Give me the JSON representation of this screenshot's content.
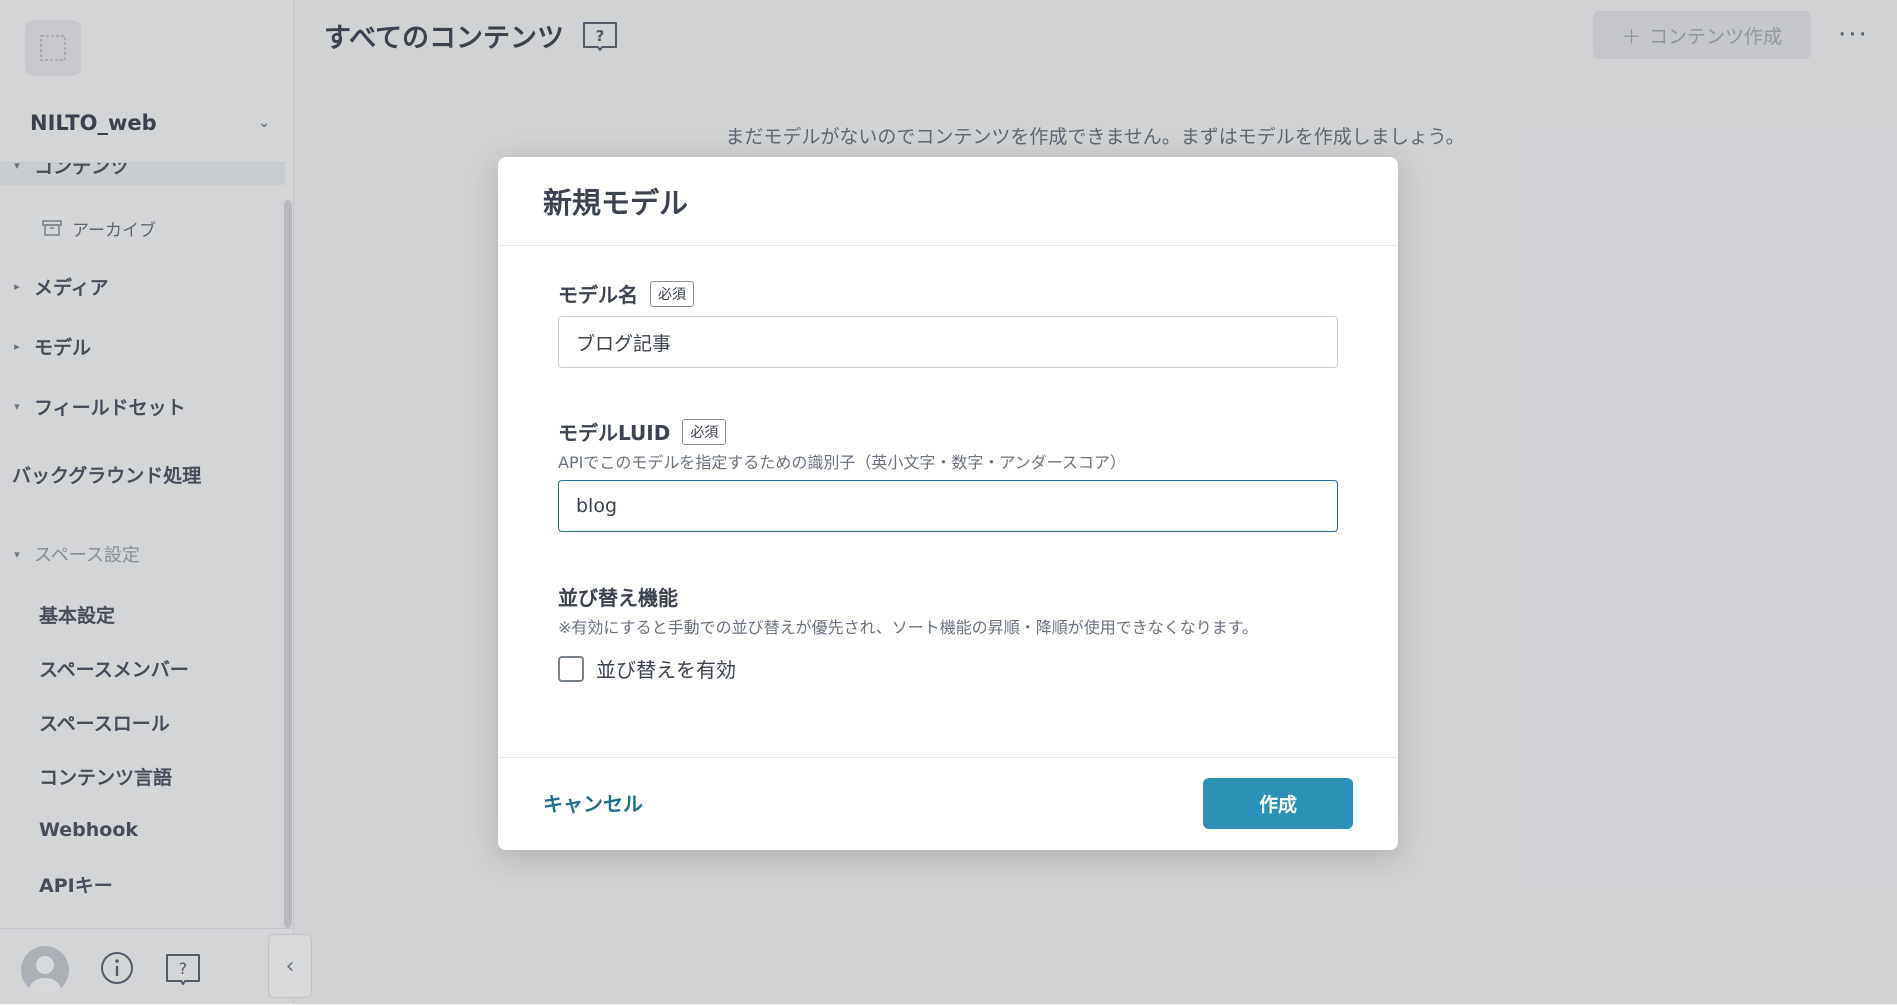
{
  "sidebar": {
    "space_name": "NILTO_web",
    "items": [
      {
        "label": "コンテンツ"
      },
      {
        "label": "アーカイブ"
      },
      {
        "label": "メディア"
      },
      {
        "label": "モデル"
      },
      {
        "label": "フィールドセット"
      },
      {
        "label": "バックグラウンド処理"
      }
    ],
    "space_settings": {
      "label": "スペース設定",
      "items": [
        {
          "label": "基本設定"
        },
        {
          "label": "スペースメンバー"
        },
        {
          "label": "スペースロール"
        },
        {
          "label": "コンテンツ言語"
        },
        {
          "label": "Webhook"
        },
        {
          "label": "APIキー"
        }
      ]
    }
  },
  "header": {
    "title": "すべてのコンテンツ",
    "create_button": "コンテンツ作成"
  },
  "main": {
    "empty_message": "まだモデルがないのでコンテンツを作成できません。まずはモデルを作成しましょう。"
  },
  "modal": {
    "title": "新規モデル",
    "model_name": {
      "label": "モデル名",
      "required": "必須",
      "value": "ブログ記事"
    },
    "model_luid": {
      "label": "モデルLUID",
      "required": "必須",
      "help": "APIでこのモデルを指定するための識別子（英小文字・数字・アンダースコア）",
      "value": "blog"
    },
    "sorting": {
      "label": "並び替え機能",
      "help": "※有効にすると手動での並び替えが優先され、ソート機能の昇順・降順が使用できなくなります。",
      "checkbox_label": "並び替えを有効",
      "checked": false
    },
    "cancel": "キャンセル",
    "submit": "作成"
  },
  "colors": {
    "primary": "#2b91b6",
    "link": "#1f6f8f",
    "focus_border": "#2a6f96"
  }
}
